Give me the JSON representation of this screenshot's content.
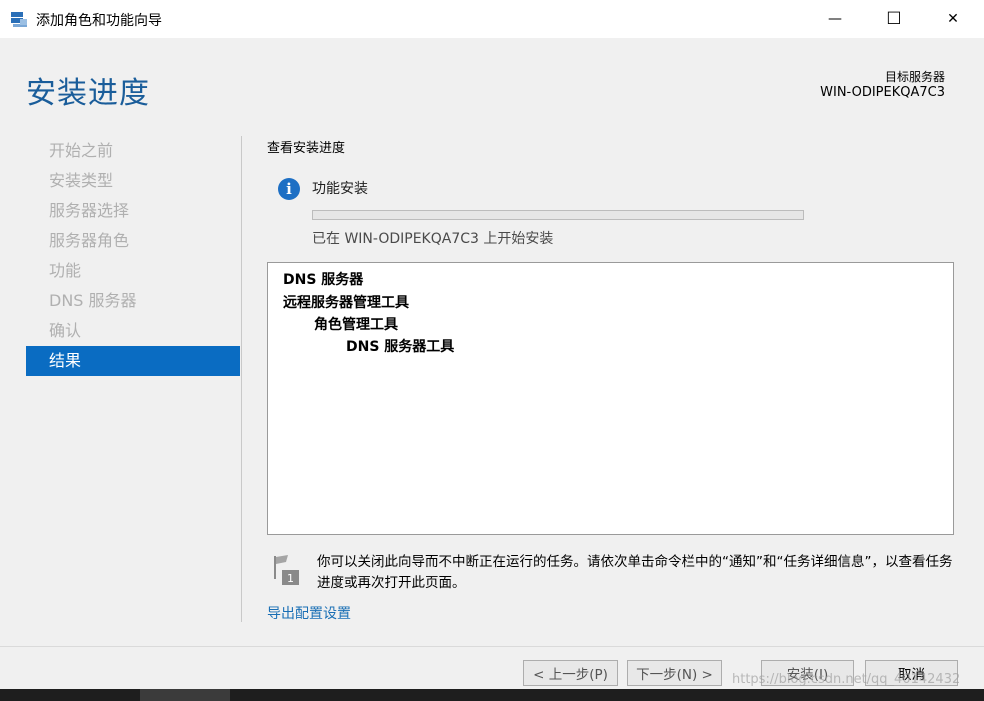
{
  "window": {
    "title": "添加角色和功能向导",
    "minimize_glyph": "—",
    "maximize_glyph": "☐",
    "close_glyph": "✕"
  },
  "header": {
    "page_title": "安装进度",
    "target_label": "目标服务器",
    "target_name": "WIN-ODIPEKQA7C3"
  },
  "nav": {
    "items": [
      {
        "label": "开始之前"
      },
      {
        "label": "安装类型"
      },
      {
        "label": "服务器选择"
      },
      {
        "label": "服务器角色"
      },
      {
        "label": "功能"
      },
      {
        "label": "DNS 服务器"
      },
      {
        "label": "确认"
      },
      {
        "label": "结果"
      }
    ],
    "active_index": 7
  },
  "main": {
    "section_label": "查看安装进度",
    "info_icon_glyph": "i",
    "feature_title": "功能安装",
    "progress_fraction": 0.0,
    "status_text": "已在 WIN-ODIPEKQA7C3 上开始安装",
    "results": [
      {
        "text": "DNS 服务器",
        "level": 0
      },
      {
        "text": "远程服务器管理工具",
        "level": 0
      },
      {
        "text": "角色管理工具",
        "level": 1
      },
      {
        "text": "DNS 服务器工具",
        "level": 2
      }
    ],
    "note_badge": "1",
    "note": "你可以关闭此向导而不中断正在运行的任务。请依次单击命令栏中的“通知”和“任务详细信息”，以查看任务进度或再次打开此页面。",
    "export_link": "导出配置设置"
  },
  "footer": {
    "prev_label": "< 上一步(P)",
    "next_label": "下一步(N) >",
    "install_label": "安装(I)",
    "cancel_label": "取消"
  },
  "overlay": {
    "watermark": "https://blog.csdn.net/qq_40142432"
  },
  "colors": {
    "accent": "#0a6cc2",
    "title_blue": "#1a5d9a",
    "link": "#1a6fb5",
    "info_icon": "#1d6fc4"
  }
}
